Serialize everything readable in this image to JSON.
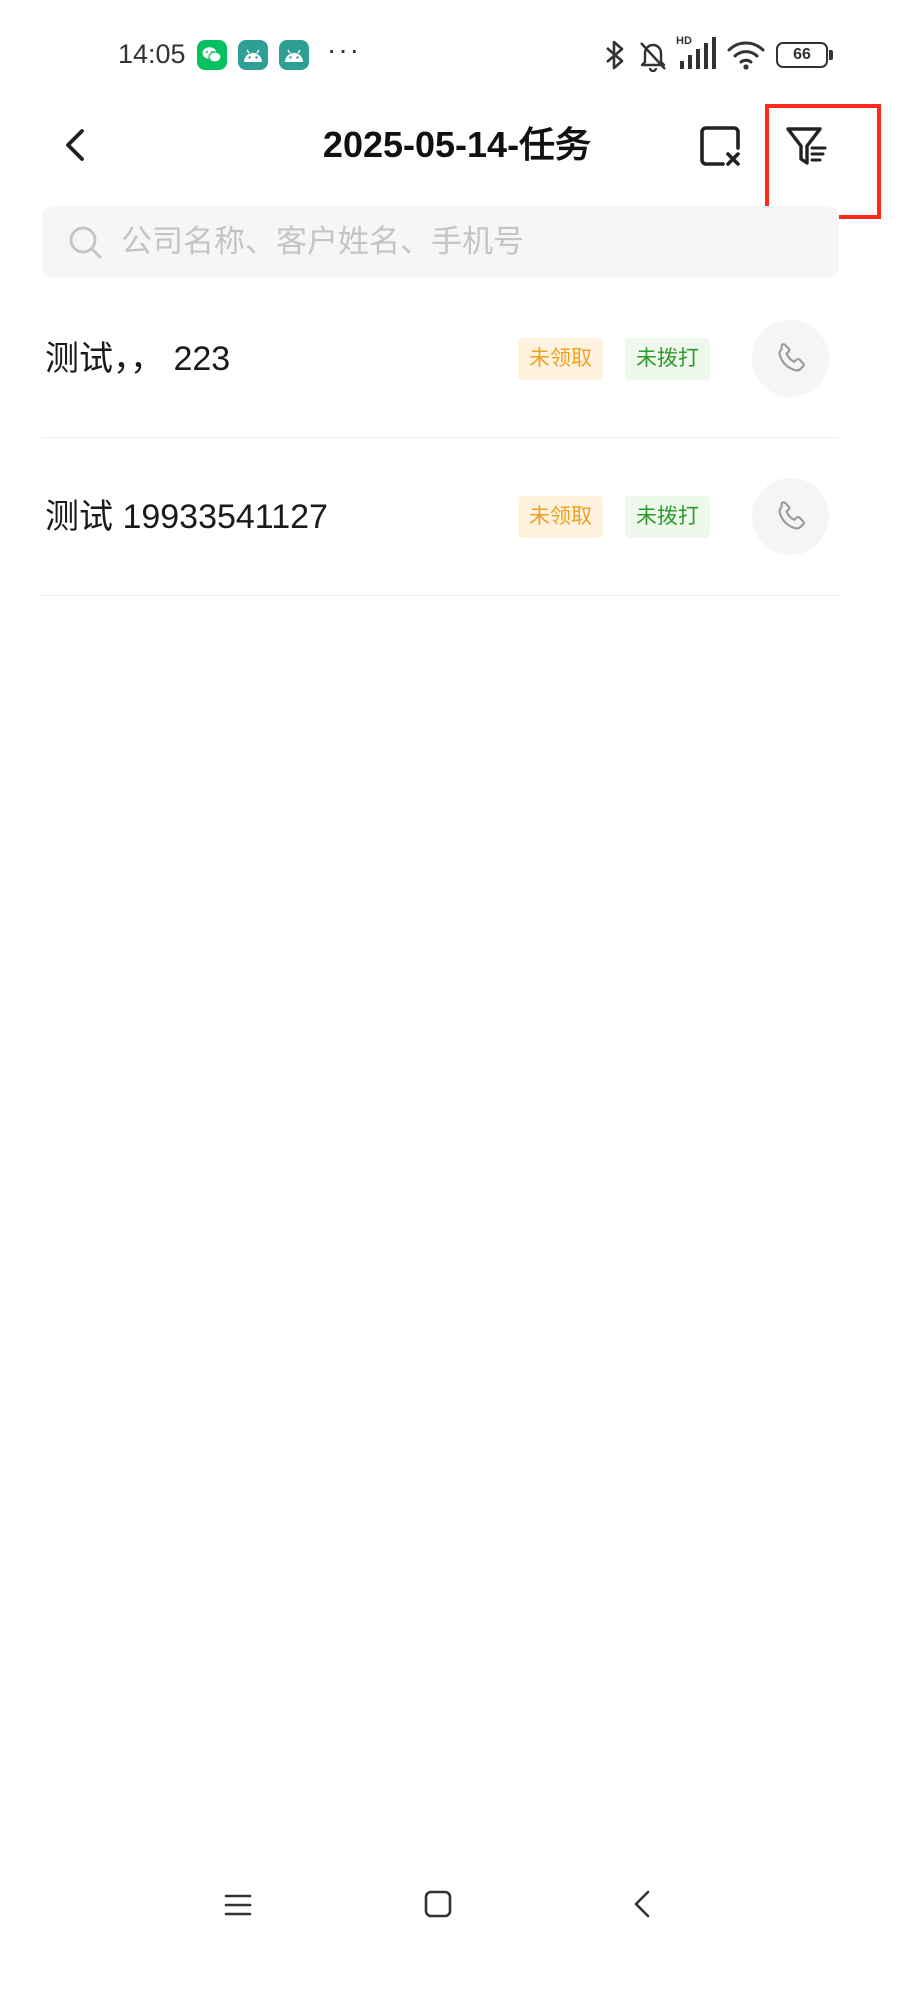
{
  "status_bar": {
    "time": "14:05",
    "more": "···",
    "hd": "HD",
    "battery": "66",
    "icons": [
      "wechat-icon",
      "android-icon",
      "android-icon",
      "bluetooth-icon",
      "bell-off-icon",
      "signal-icon",
      "wifi-icon",
      "battery-icon"
    ]
  },
  "header": {
    "title": "2025-05-14-任务",
    "icons": {
      "back": "chevron-left-icon",
      "clear": "clear-selection-icon",
      "filter": "filter-icon"
    }
  },
  "search": {
    "placeholder": "公司名称、客户姓名、手机号",
    "value": "",
    "icon": "search-icon"
  },
  "tasks": [
    {
      "name": "测试，， 223",
      "claim_status": "未领取",
      "call_status": "未拨打",
      "action_icon": "phone-icon"
    },
    {
      "name": "测试 19933541127",
      "claim_status": "未领取",
      "call_status": "未拨打",
      "action_icon": "phone-icon"
    }
  ],
  "nav_bar": {
    "icons": [
      "menu-icon",
      "home-icon",
      "back-icon"
    ]
  },
  "colors": {
    "bg": "#ffffff",
    "text": "#1a1a1a",
    "placeholder": "#c4c4c4",
    "search-bg": "#f6f6f6",
    "tag-orange-bg": "#fff3e0",
    "tag-orange-text": "#f0a020",
    "tag-green-bg": "#eef8ec",
    "tag-green-text": "#2e9a2e",
    "highlight": "#ff2a1a",
    "divider": "#eeeeee"
  }
}
